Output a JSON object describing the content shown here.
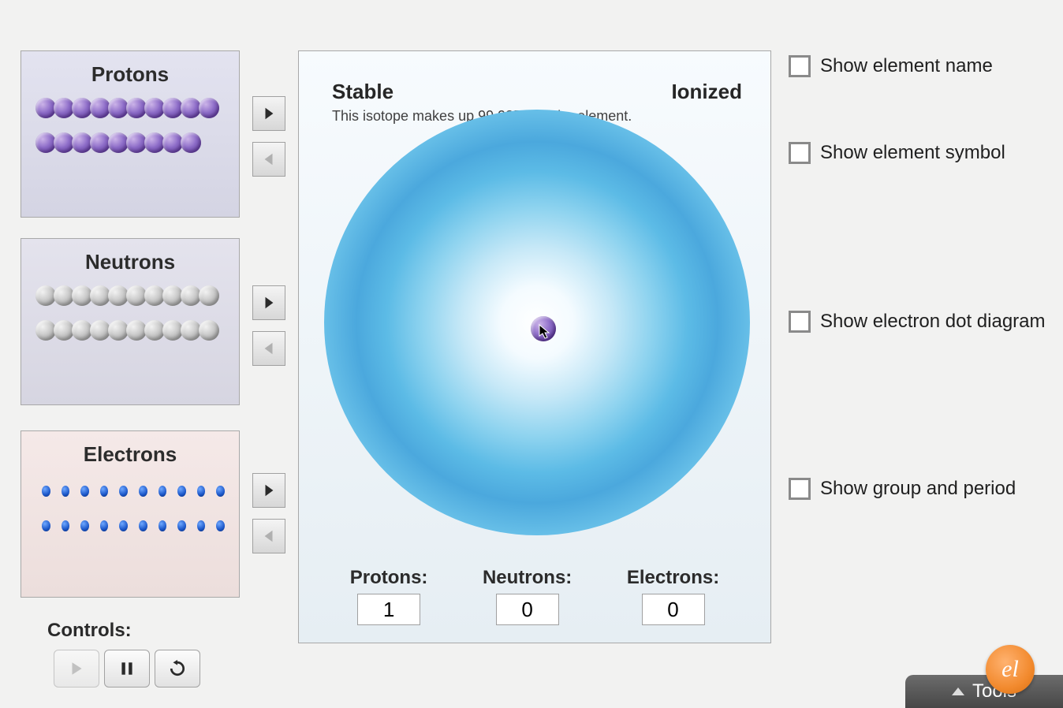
{
  "bins": {
    "protons": {
      "title": "Protons",
      "row1": 10,
      "row2": 9
    },
    "neutrons": {
      "title": "Neutrons",
      "row1": 10,
      "row2": 10
    },
    "electrons": {
      "title": "Electrons",
      "row1": 10,
      "row2": 10
    }
  },
  "atom": {
    "stability_label": "Stable",
    "charge_label": "Ionized",
    "isotope_text": "This isotope makes up 99.985% of the element."
  },
  "counts": {
    "protons_label": "Protons:",
    "protons_value": "1",
    "neutrons_label": "Neutrons:",
    "neutrons_value": "0",
    "electrons_label": "Electrons:",
    "electrons_value": "0"
  },
  "checkboxes": {
    "show_name": "Show element name",
    "show_symbol": "Show element symbol",
    "show_dot": "Show electron dot diagram",
    "show_group": "Show group and period"
  },
  "controls": {
    "label": "Controls:"
  },
  "tools": {
    "label": "Tools"
  },
  "brand": {
    "glyph": "el"
  }
}
